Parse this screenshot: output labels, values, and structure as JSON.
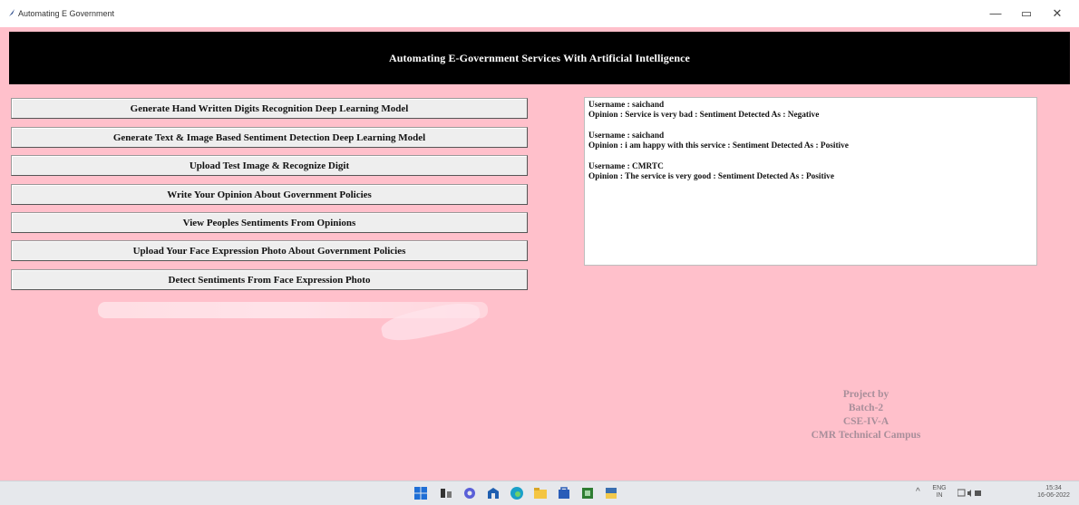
{
  "window": {
    "title": "Automating E Government",
    "minimize": "—",
    "restore": "▭",
    "close": "✕"
  },
  "header": {
    "title": "Automating E-Government Services With Artificial Intelligence"
  },
  "buttons": [
    "Generate Hand Written Digits Recognition Deep Learning Model",
    "Generate Text & Image Based Sentiment Detection Deep Learning Model",
    "Upload Test Image & Recognize Digit",
    "Write Your Opinion About Government Policies",
    "View Peoples Sentiments From Opinions",
    "Upload Your Face Expression Photo About Government Policies",
    "Detect Sentiments From Face Expression Photo"
  ],
  "output": {
    "entries": [
      {
        "username": "Username : saichand",
        "opinion": "Opinion  : Service is very bad : Sentiment Detected As : Negative"
      },
      {
        "username": "Username : saichand",
        "opinion": "Opinion  : i am happy with this service : Sentiment Detected As : Positive"
      },
      {
        "username": "Username : CMRTC",
        "opinion": "Opinion  : The service is very good : Sentiment Detected As : Positive"
      }
    ]
  },
  "credits": {
    "line1": "Project by",
    "line2": "Batch-2",
    "line3": "CSE-IV-A",
    "line4": "CMR Technical Campus"
  },
  "taskbar": {
    "icons": [
      "windows-start-icon",
      "task-view-icon",
      "chat-icon",
      "store-icon",
      "edge-browser-icon",
      "file-explorer-icon",
      "ms-store-icon",
      "app-icon",
      "python-app-icon"
    ],
    "tray": {
      "lang_top": "ENG",
      "lang_bottom": "IN",
      "time": "15:34",
      "date": "16-06-2022"
    }
  },
  "colors": {
    "background": "#ffc0cb",
    "banner": "#000000",
    "button": "#eeeeee",
    "credits_text": "#a88e9a"
  }
}
